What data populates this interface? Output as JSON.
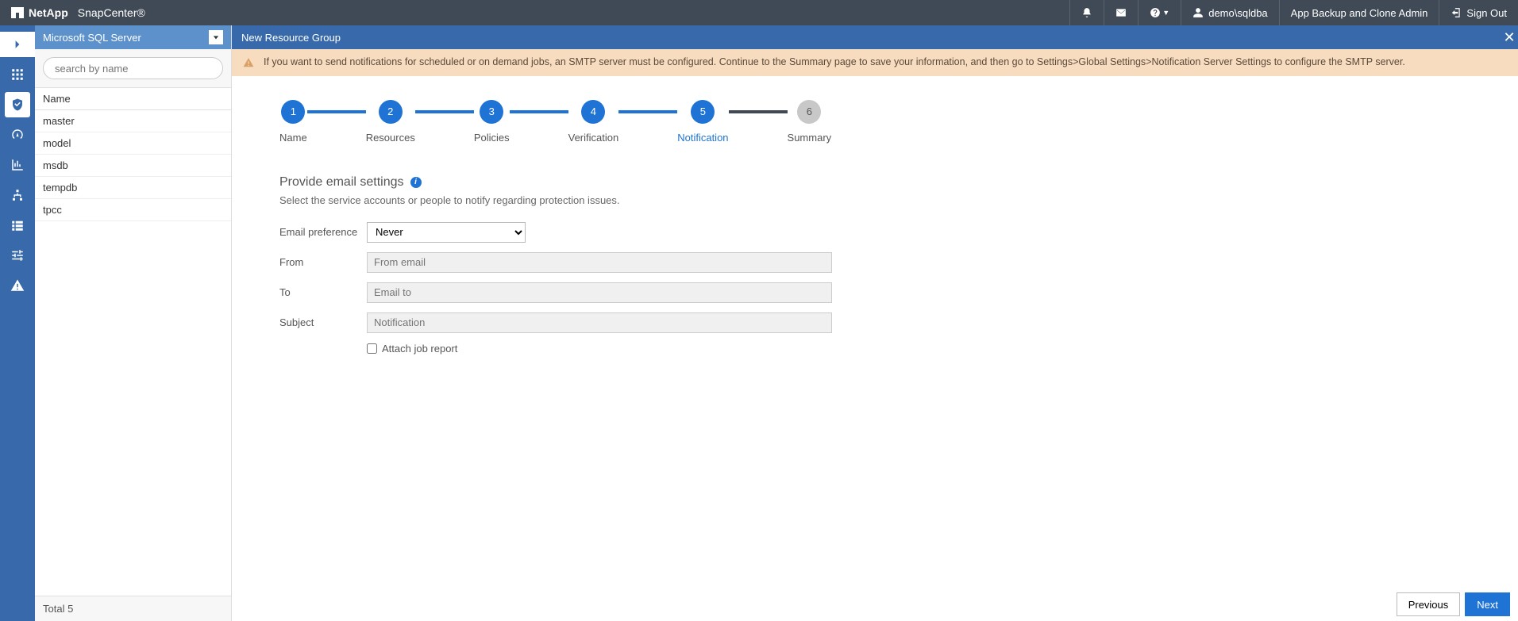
{
  "brand": {
    "logo_text": "NetApp",
    "product": "SnapCenter®"
  },
  "topbar": {
    "user": "demo\\sqldba",
    "role": "App Backup and Clone Admin",
    "signout": "Sign Out"
  },
  "sidepanel": {
    "plugin": "Microsoft SQL Server",
    "search_placeholder": "search by name",
    "column_header": "Name",
    "items": [
      "master",
      "model",
      "msdb",
      "tempdb",
      "tpcc"
    ],
    "total_label": "Total 5"
  },
  "main": {
    "title": "New Resource Group",
    "banner": "If you want to send notifications for scheduled or on demand jobs, an SMTP server must be configured. Continue to the Summary page to save your information, and then go to Settings>Global Settings>Notification Server Settings to configure the SMTP server."
  },
  "wizard": {
    "steps": [
      {
        "num": "1",
        "label": "Name"
      },
      {
        "num": "2",
        "label": "Resources"
      },
      {
        "num": "3",
        "label": "Policies"
      },
      {
        "num": "4",
        "label": "Verification"
      },
      {
        "num": "5",
        "label": "Notification"
      },
      {
        "num": "6",
        "label": "Summary"
      }
    ]
  },
  "form": {
    "section_title": "Provide email settings",
    "section_sub": "Select the service accounts or people to notify regarding protection issues.",
    "email_pref_label": "Email preference",
    "email_pref_value": "Never",
    "from_label": "From",
    "from_placeholder": "From email",
    "to_label": "To",
    "to_placeholder": "Email to",
    "subject_label": "Subject",
    "subject_placeholder": "Notification",
    "attach_label": "Attach job report"
  },
  "buttons": {
    "previous": "Previous",
    "next": "Next"
  }
}
